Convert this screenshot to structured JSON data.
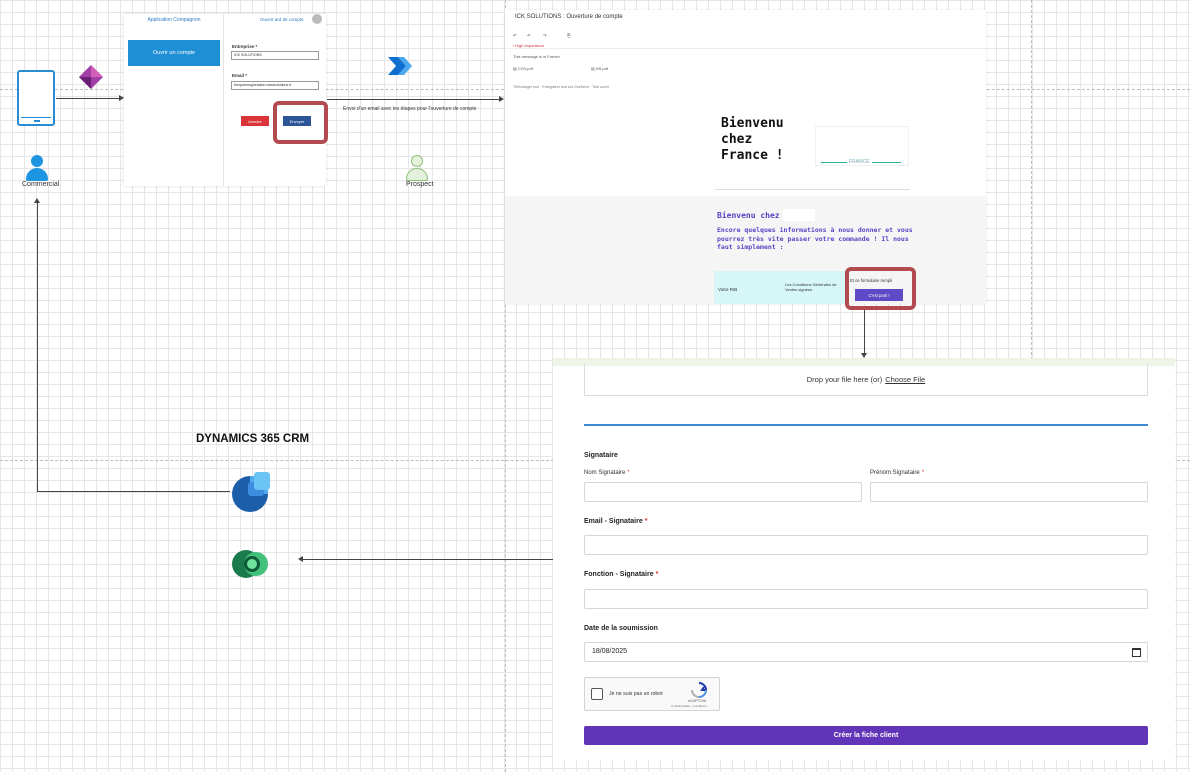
{
  "actors": {
    "commercial": "Commercial",
    "prospect": "Prospect"
  },
  "app": {
    "title": "Application Compagnon",
    "open_button": "Ouvrir un compte",
    "header_right": "Ouvert ard de compte",
    "company_label": "Entreprise *",
    "company_value": "ICK SOLUTIONS",
    "email_label": "Email *",
    "email_value": "thequeensghelation.clarasolutions.fr",
    "cancel_button": "Annuler",
    "send_button": "Envoyer"
  },
  "edge_label": "Envoi d'un email avec les étapes pour l'ouverture de compte",
  "email": {
    "subject": "ICK SOLUTIONS : Ouverture de compte",
    "importance": "High importance",
    "language_note": "This message is in French",
    "attachment1": "CGV.pdf",
    "attachment2": "KB.pdf",
    "links": "Télécharger tout · Enregistrer tout sur OneDrive · Tout ouvrir",
    "welcome_big": "Bienvenu chez",
    "welcome_big2": "France !",
    "logo_text": "FRANCE",
    "welcome_line": "Bienvenu chez",
    "paragraph": "Encore quelques informations à nous donner et vous pourrez très vite passer votre commande ! Il nous faut simplement :",
    "row_left": "Votre RIB",
    "row_mid": "Les Conditions Générales de Ventes signées",
    "form_done": "Et ce formulaire rempli",
    "go_button": "C'est parti !"
  },
  "crm": {
    "title": "DYNAMICS 365 CRM"
  },
  "form": {
    "drop_text": "Drop your file here (or)",
    "choose_file": "Choose File",
    "signataire": "Signataire",
    "nom_label": "Nom Signataire",
    "prenom_label": "Prénom Signataire",
    "email_label": "Email - Signataire",
    "fonction_label": "Fonction - Signataire",
    "date_label": "Date de la soumission",
    "date_value": "18/08/2025",
    "req_mark": "*",
    "captcha_text": "Je ne suis pas un robot",
    "captcha_brand": "reCAPTCHA",
    "captcha_terms": "Confidentialité - Conditions",
    "submit": "Créer la fiche client"
  },
  "colors": {
    "accent_blue": "#1e8fd5",
    "highlight_red": "#b14b4f",
    "purple": "#5b3fc4",
    "submit_purple": "#6235b8"
  }
}
